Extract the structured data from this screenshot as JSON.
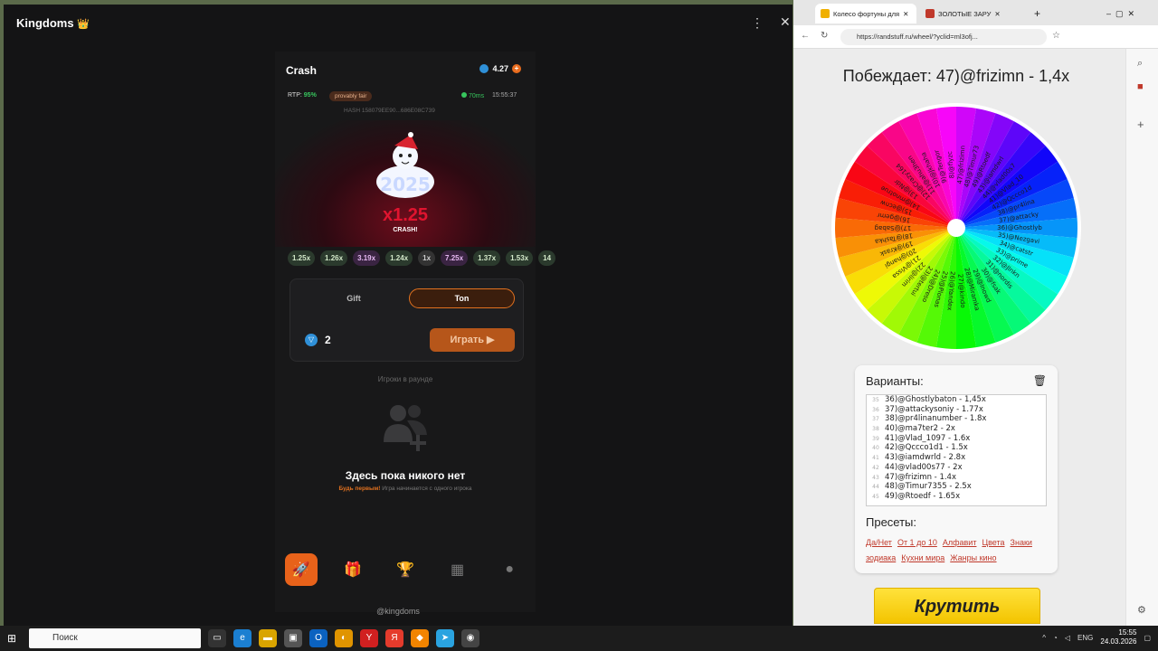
{
  "telegram": {
    "window_title": "Kingdoms",
    "crown": "👑",
    "menu_icon": "⋮",
    "close_icon": "✕",
    "footer": "@kingdoms"
  },
  "game": {
    "title": "Crash",
    "balance": "4.27",
    "rtp_label": "RTP:",
    "rtp_value": "95%",
    "provably_fair": "provably fair",
    "ping": "70ms",
    "time": "15:55:37",
    "hash": "HASH    158079EE90...686E08C739",
    "multiplier": "x1.25",
    "crashed_label": "CRASH!",
    "history": [
      "1.25x",
      "1.26x",
      "3.19x",
      "1.24x",
      "1x",
      "7.25x",
      "1.37x",
      "1.53x",
      "14"
    ],
    "tabs": {
      "gift": "Gift",
      "ton": "Ton"
    },
    "bet_value": "2",
    "play_label": "Играть",
    "players_title": "Игроки в раунде",
    "empty_title": "Здесь пока никого нет",
    "empty_sub_highlight": "Будь первым!",
    "empty_sub_rest": " Игра начинается с одного игрока",
    "nav": [
      "crash-nav",
      "gifts-nav",
      "trophy-nav",
      "games-nav",
      "profile-nav"
    ]
  },
  "browser": {
    "tab1": "Колесо фортуны для",
    "tab2": "ЗОЛОТЫЕ ЗАРУ",
    "url": "https://randstuff.ru/wheel/?yclid=ml3ofj...",
    "winner": "Побеждает: 47)@frizimn - 1,4x",
    "variants_title": "Варианты:",
    "variants": [
      {
        "n": "35",
        "text": "36)@Ghostlybaton - 1,45x"
      },
      {
        "n": "36",
        "text": "37)@attackysoniy - 1.77x"
      },
      {
        "n": "37",
        "text": "38)@pr4linanumber - 1.8x"
      },
      {
        "n": "38",
        "text": "40)@ma7ter2 - 2x"
      },
      {
        "n": "39",
        "text": "41)@Vlad_1097 - 1.6x"
      },
      {
        "n": "40",
        "text": "42)@Qccco1d1 - 1.5x"
      },
      {
        "n": "41",
        "text": "43)@iamdwrld - 2.8x"
      },
      {
        "n": "42",
        "text": "44)@vlad00s77 - 2x"
      },
      {
        "n": "43",
        "text": "47)@frizimn - 1.4x"
      },
      {
        "n": "44",
        "text": "48)@Timur7355 - 2.5x"
      },
      {
        "n": "45",
        "text": "49)@Rtoedf - 1.65x"
      }
    ],
    "presets_title": "Пресеты:",
    "presets": [
      "Да/Нет",
      "От 1 до 10",
      "Алфавит",
      "Цвета",
      "Знаки зодиака",
      "Кухни мира",
      "Жанры кино"
    ],
    "spin_label": "Крутить",
    "wheel_labels": [
      "47)@frizimn",
      "48)@Timur73",
      "49)@Rtoedf",
      "43)@iamdwrl",
      "44)@vlad00s7",
      "41)@Vlad_10",
      "42)@Qccco1d",
      "38)@pr4lina",
      "37)@attacky",
      "36)@Ghostlyb",
      "35)@Nezgavi",
      "34)@catstr",
      "33)@prime",
      "32)@Jlnkn",
      "31)@nordis",
      "30)@fsak",
      "29)@Inowd",
      "28)@Miramka",
      "27)@kindo",
      "26)@Yandex",
      "25)@Plonas",
      "24)@Dreso",
      "23)@tertui",
      "22)@lirim",
      "21)@Vissa",
      "20)@hangi",
      "19)@Krask",
      "18)@Tashka",
      "17)@Sabag",
      "16)@gemr",
      "15)@ecnw",
      "14)@mnotrue",
      "13)@Ndr",
      "12)@Crazy164",
      "11)@ahu3hen",
      "10)@Jkhaha",
      "9)@Tengor",
      "8)@flyzc"
    ]
  },
  "taskbar": {
    "search_placeholder": "Поиск",
    "lang": "ENG",
    "time": "15:55",
    "date": "24.03.2026"
  }
}
